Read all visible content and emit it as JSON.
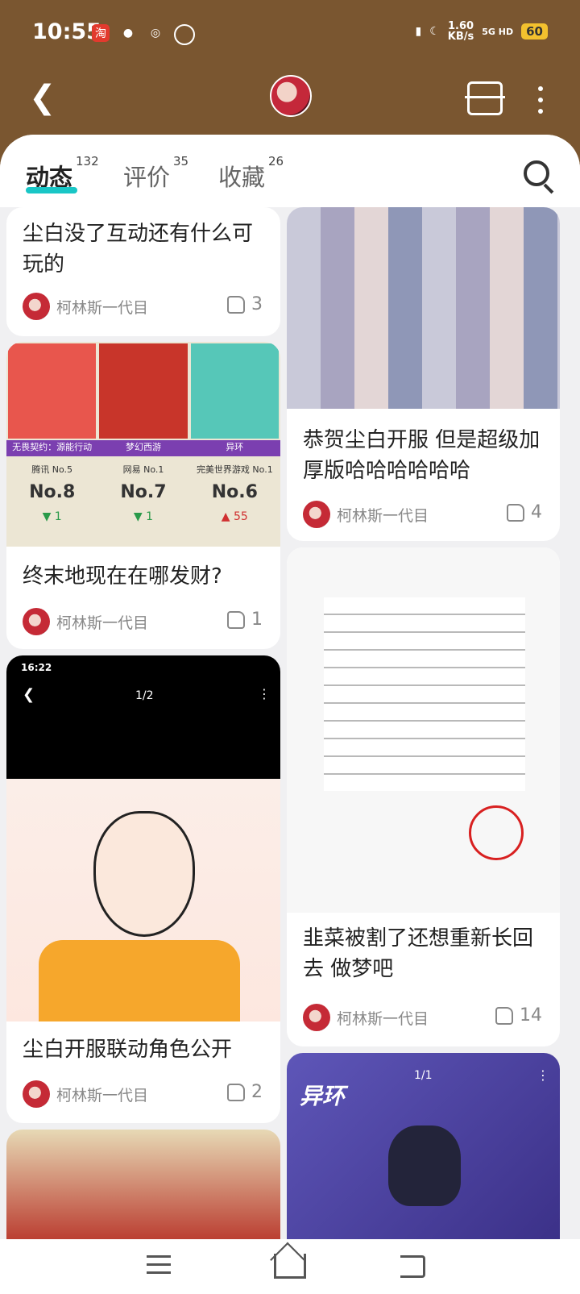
{
  "status": {
    "time": "10:55",
    "speed_value": "1.60",
    "speed_unit": "KB/s",
    "network": "5G HD",
    "battery": "60"
  },
  "tabs": [
    {
      "label": "动态",
      "count": "132"
    },
    {
      "label": "评价",
      "count": "35"
    },
    {
      "label": "收藏",
      "count": "26"
    }
  ],
  "left_column": [
    {
      "title": "尘白没了互动还有什么可玩的",
      "author": "柯林斯一代目",
      "likes": "3"
    },
    {
      "title": "终末地现在在哪发财?",
      "author": "柯林斯一代目",
      "likes": "1",
      "ranking": [
        {
          "name": "无畏契约：源能行动",
          "sub": "腾讯 No.5",
          "rank": "No.8",
          "delta": "▼ 1"
        },
        {
          "name": "梦幻西游",
          "sub": "网易 No.1",
          "rank": "No.7",
          "delta": "▼ 1"
        },
        {
          "name": "异环",
          "sub": "完美世界游戏 No.1",
          "rank": "No.6",
          "delta": "▲ 55"
        }
      ]
    },
    {
      "title": "尘白开服联动角色公开",
      "author": "柯林斯一代目",
      "likes": "2",
      "shot_time": "16:22",
      "shot_page": "1/2"
    }
  ],
  "right_column": [
    {
      "title": "恭贺尘白开服 但是超级加厚版哈哈哈哈哈哈",
      "author": "柯林斯一代目",
      "likes": "4"
    },
    {
      "title": "韭菜被割了还想重新长回去 做梦吧",
      "author": "柯林斯一代目",
      "likes": "14"
    },
    {
      "overlay_logo": "异环",
      "overlay_page": "1/1"
    }
  ],
  "colors": {
    "brand_brown": "#7a5630",
    "accent_teal": "#19c6c6"
  },
  "icons": [
    "back-arrow-icon",
    "scan-icon",
    "more-vertical-icon",
    "search-icon",
    "thumb-up-icon",
    "menu-icon",
    "home-icon",
    "return-icon"
  ]
}
